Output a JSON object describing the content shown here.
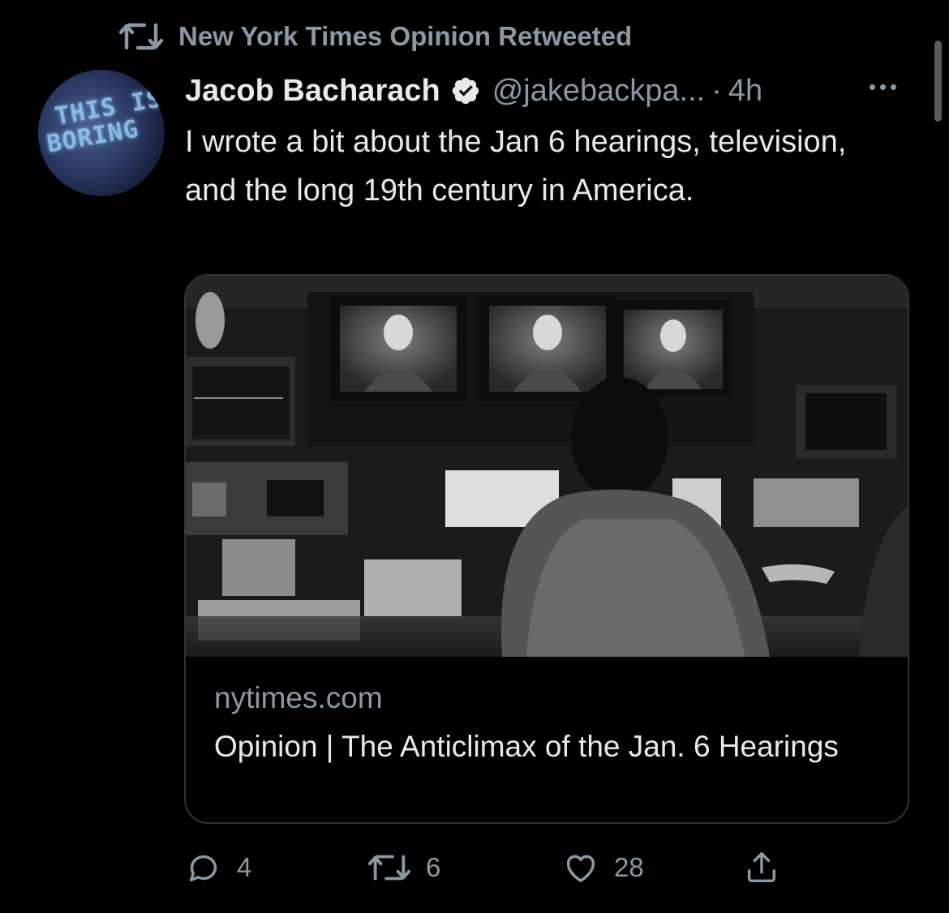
{
  "context": {
    "label": "New York Times Opinion Retweeted",
    "icon": "retweet-icon"
  },
  "avatar": {
    "line1": "THIS IS",
    "line2": "BORING"
  },
  "tweet": {
    "author_name": "Jacob Bacharach",
    "handle": "@jakebackpa...",
    "separator": "·",
    "time": "4h",
    "text": "I wrote a bit about the Jan 6 hearings, television, and the long 19th century in America."
  },
  "card": {
    "domain": "nytimes.com",
    "title": "Opinion | The Anticlimax of the Jan. 6 Hearings"
  },
  "actions": {
    "reply_count": "4",
    "retweet_count": "6",
    "like_count": "28"
  },
  "colors": {
    "background": "#000000",
    "text": "#e7e9ea",
    "muted": "#8b98a5",
    "border": "#2f3336"
  }
}
